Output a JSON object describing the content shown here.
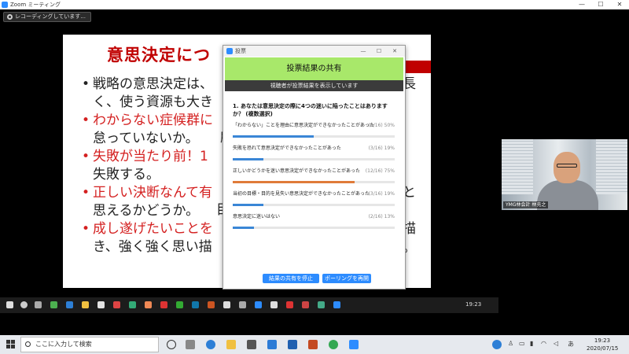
{
  "zoom": {
    "window_title": "Zoom ミーティング",
    "recording_status": "レコーディングしています...",
    "min_glyph": "—",
    "max_glyph": "☐",
    "close_glyph": "✕"
  },
  "slide": {
    "title": "意思決定につ",
    "bullets": [
      {
        "color": "black",
        "line1": "戦略の意思決定は、",
        "line2": "く、使う資源も大き"
      },
      {
        "color": "red",
        "line1": "わからない症候群に",
        "line2": "怠っていないか。"
      },
      {
        "color": "red",
        "line1": "失敗が当たり前！1",
        "line2": "失敗する。"
      },
      {
        "color": "red",
        "line1": "正しい決断なんて有",
        "line2": "思えるかどうか。"
      },
      {
        "color": "red",
        "line1": "成し遂げたいことを",
        "line2": "き、強く強く思い描"
      }
    ],
    "fragments": [
      "長",
      "顧",
      "と",
      "目",
      "描",
      "。"
    ]
  },
  "poll": {
    "window_title": "投票",
    "header": "投票結果の共有",
    "subheader": "視聴者が投票結果を表示しています",
    "question": "1. あなたは意思決定の際に4つの迷いに陥ったことはありますか？ (複数選択)",
    "options": [
      {
        "label": "「わからない」ことを理由に意思決定ができなかったことがあった",
        "count": "(8/16) 50%",
        "pct": 50,
        "color": "#3a86d6"
      },
      {
        "label": "失敗を恐れて意思決定ができなかったことがあった",
        "count": "(3/16) 19%",
        "pct": 19,
        "color": "#3a86d6"
      },
      {
        "label": "正しいかどうかを迷い意思決定ができなかったことがあった",
        "count": "(12/16) 75%",
        "pct": 75,
        "color": "#e07b39"
      },
      {
        "label": "当初の目標・目的を見失い意思決定ができなかったことがあった",
        "count": "(3/16) 19%",
        "pct": 19,
        "color": "#3a86d6"
      },
      {
        "label": "意思決定に迷いはない",
        "count": "(2/16) 13%",
        "pct": 13,
        "color": "#3a86d6"
      }
    ],
    "stop_sharing_label": "結果の共有を停止",
    "restart_label": "ポーリングを再開"
  },
  "camera": {
    "participant_name": "YMG林会計 林充之"
  },
  "remote_taskbar": {
    "clock": "19:23"
  },
  "taskbar": {
    "search_placeholder": "ここに入力して検索",
    "ime": "あ",
    "time": "19:23",
    "date": "2020/07/15"
  }
}
